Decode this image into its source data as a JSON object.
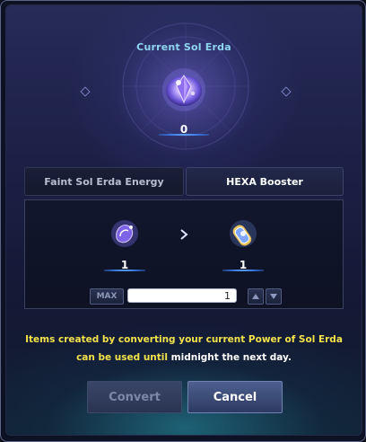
{
  "header": {
    "title": "Current Sol Erda",
    "amount": "0"
  },
  "tabs": [
    {
      "label": "Faint Sol Erda Energy",
      "active": false
    },
    {
      "label": "HEXA Booster",
      "active": true
    }
  ],
  "conversion": {
    "from_amount": "1",
    "to_amount": "1",
    "max_label": "MAX",
    "quantity_value": "1"
  },
  "notice": {
    "line1": "Items created by converting your current Power of Sol Erda",
    "line2_yellow": "can be used until",
    "line2_white": "midnight the next day."
  },
  "buttons": {
    "convert_label": "Convert",
    "cancel_label": "Cancel"
  },
  "colors": {
    "title": "#8fd6f0",
    "notice_highlight": "#f2e24a",
    "accent_glow": "#3d86ff"
  },
  "icons": {
    "currency": "sol-erda-crystal-icon",
    "from_item": "faint-sol-erda-energy-icon",
    "to_item": "hexa-booster-icon",
    "arrow": "chevron-right-icon"
  }
}
